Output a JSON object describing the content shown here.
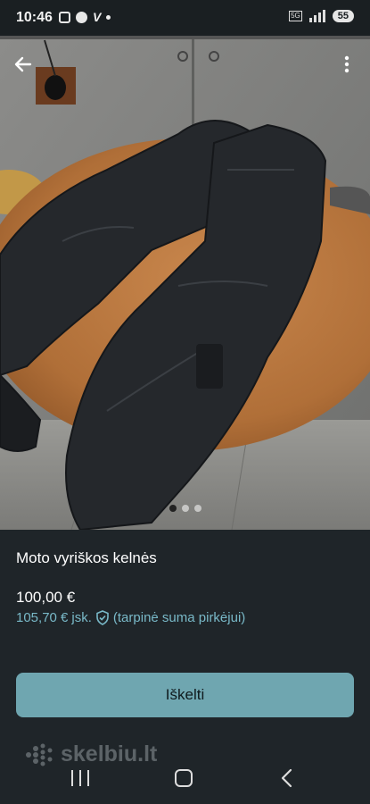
{
  "status_bar": {
    "time": "10:46",
    "network": "5G",
    "battery": "55"
  },
  "listing": {
    "title": "Moto vyriškos kelnės",
    "price": "100,00 €",
    "price_protected": "105,70 €",
    "price_protected_suffix": "jsk.",
    "protection_note": "(tarpinė suma pirkėjui)",
    "photo_count": 3,
    "photo_active_index": 0
  },
  "buttons": {
    "primary_label": "Iškelti"
  },
  "brand": {
    "logo_text": "skelbiu.lt"
  },
  "colors": {
    "background": "#1f2529",
    "accent": "#6fa6b0",
    "link": "#79b9c8"
  },
  "icons": {
    "back": "arrow-left-icon",
    "more": "more-vertical-icon",
    "shield": "shield-check-icon"
  }
}
